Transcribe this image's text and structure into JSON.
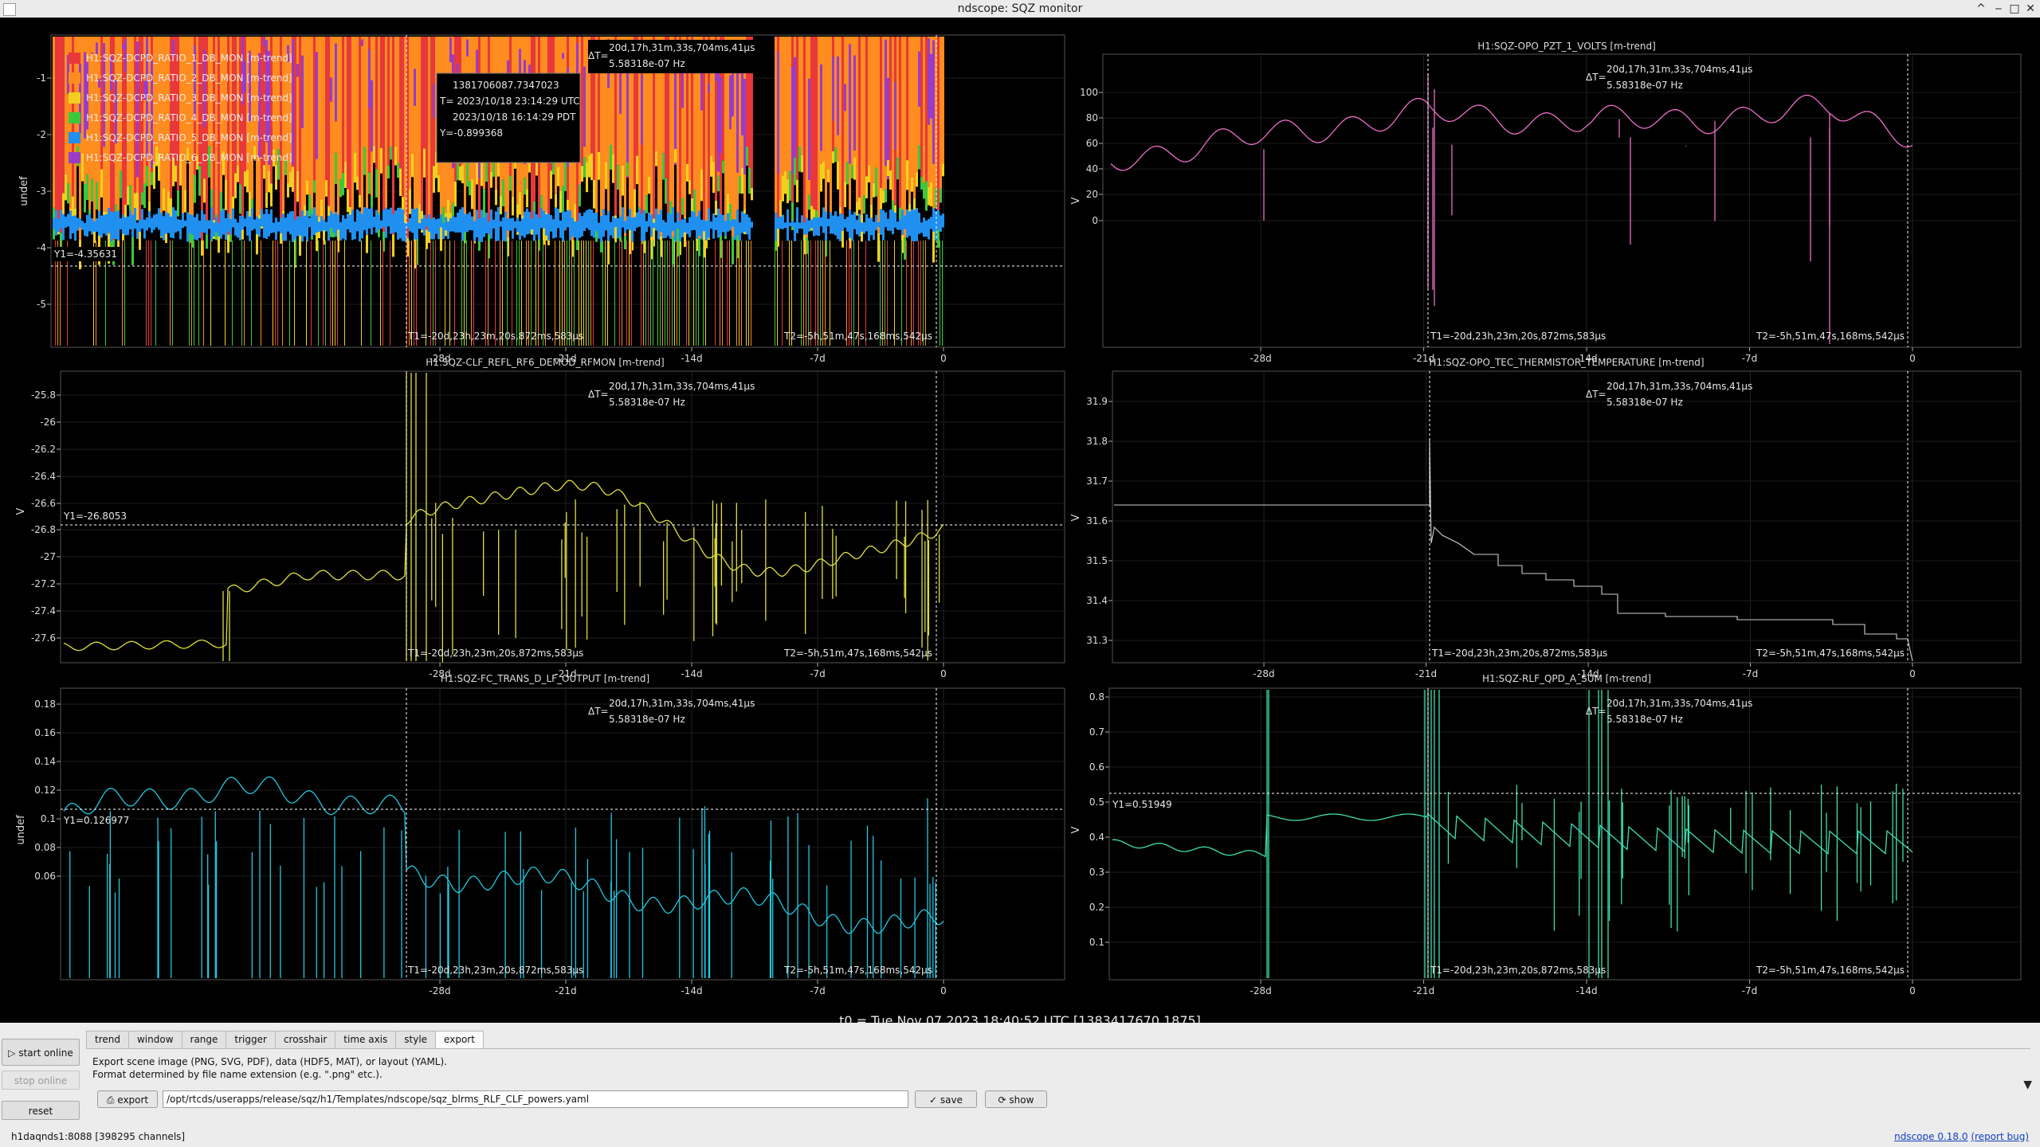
{
  "window": {
    "title": "ndscope: SQZ monitor",
    "buttons": {
      "up": "^",
      "minimize": "‒",
      "maximize": "□",
      "close": "✕"
    }
  },
  "common": {
    "deltaT_label": "ΔT=",
    "deltaT_value": "20d,17h,31m,33s,704ms,41μs",
    "deltaT_freq": "5.58318e-07 Hz",
    "t1_label": "T1=-20d,23h,23m,20s,872ms,583μs",
    "t2_label": "T2=-5h,51m,47s,168ms,542μs",
    "x_ticks": [
      "-28d",
      "-21d",
      "-14d",
      "-7d",
      "0"
    ],
    "x_tick_days": [
      -28,
      -21,
      -14,
      -7,
      0
    ]
  },
  "plots": [
    {
      "title": "",
      "ylabel": "undef",
      "y_ticks": [
        "-1",
        "-2",
        "-3",
        "-4",
        "-5"
      ],
      "legend": [
        {
          "name": "H1:SQZ-DCPD_RATIO_1_DB_MON [m-trend]",
          "color": "#e8383a"
        },
        {
          "name": "H1:SQZ-DCPD_RATIO_2_DB_MON [m-trend]",
          "color": "#ff8c1e"
        },
        {
          "name": "H1:SQZ-DCPD_RATIO_3_DB_MON [m-trend]",
          "color": "#f0d01e"
        },
        {
          "name": "H1:SQZ-DCPD_RATIO_4_DB_MON [m-trend]",
          "color": "#3cc83c"
        },
        {
          "name": "H1:SQZ-DCPD_RATIO_5_DB_MON [m-trend]",
          "color": "#2090f0"
        },
        {
          "name": "H1:SQZ-DCPD_RATIO_6_DB_MON [m-trend]",
          "color": "#9a3cc8"
        }
      ],
      "y1_label": "Y1=-4.35631",
      "tooltip": [
        "1381706087.7347023",
        "T= 2023/10/18 23:14:29 UTC",
        "2023/10/18 16:14:29 PDT",
        "Y=-0.899368"
      ]
    },
    {
      "title": "H1:SQZ-OPO_PZT_1_VOLTS [m-trend]",
      "ylabel": "V",
      "y_ticks": [
        "100",
        "80",
        "60",
        "40",
        "20",
        "0"
      ]
    },
    {
      "title": "H1:SQZ-CLF_REFL_RF6_DEMOD_RFMON [m-trend]",
      "ylabel": "V",
      "y_ticks": [
        "-25.8",
        "-26",
        "-26.2",
        "-26.4",
        "-26.6",
        "-26.8",
        "-27",
        "-27.2",
        "-27.4",
        "-27.6"
      ],
      "y1_label": "Y1=-26.8053"
    },
    {
      "title": "H1:SQZ-OPO_TEC_THERMISTOR_TEMPERATURE [m-trend]",
      "ylabel": "V",
      "y_ticks": [
        "31.9",
        "31.8",
        "31.7",
        "31.6",
        "31.5",
        "31.4",
        "31.3"
      ]
    },
    {
      "title": "H1:SQZ-FC_TRANS_D_LF_OUTPUT [m-trend]",
      "ylabel": "undef",
      "y_ticks": [
        "0.18",
        "0.16",
        "0.14",
        "0.12",
        "0.1",
        "0.08",
        "0.06"
      ],
      "y1_label": "Y1=0.126977"
    },
    {
      "title": "H1:SQZ-RLF_QPD_A_SUM [m-trend]",
      "ylabel": "V",
      "y_ticks": [
        "0.8",
        "0.7",
        "0.6",
        "0.5",
        "0.4",
        "0.3",
        "0.2",
        "0.1"
      ],
      "y1_label": "Y1=0.51949"
    }
  ],
  "t0": "t0 = Tue Nov 07 2023 18:40:52 UTC [1383417670.1875]",
  "controls": {
    "start_online": "start online",
    "stop_online": "stop online",
    "reset": "reset",
    "tabs": [
      "trend",
      "window",
      "range",
      "trigger",
      "crosshair",
      "time axis",
      "style",
      "export"
    ],
    "active_tab": "export",
    "export_desc_1": "Export scene image (PNG, SVG, PDF), data (HDF5, MAT), or layout (YAML).",
    "export_desc_2": "Format determined by file name extension (e.g. \".png\" etc.).",
    "export_button": "export",
    "path_value": "/opt/rtcds/userapps/release/sqz/h1/Templates/ndscope/sqz_blrms_RLF_CLF_powers.yaml",
    "save_button": "save",
    "show_button": "show"
  },
  "status": {
    "server": "h1daqnds1:8088",
    "channels": "[398295 channels]",
    "version": "ndscope 0.18.0",
    "report": "(report bug)"
  }
}
